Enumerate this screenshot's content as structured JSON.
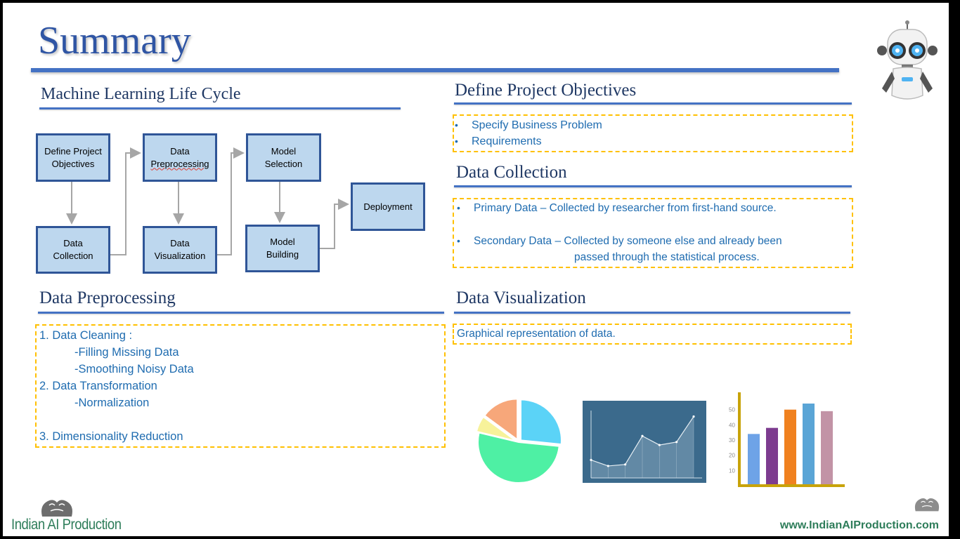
{
  "slide": {
    "title": "Summary",
    "footer_brand": "Indian AI Production",
    "footer_url": "www.IndianAIProduction.com"
  },
  "lifecycle": {
    "heading": "Machine Learning Life Cycle",
    "steps": {
      "define": "Define Project\nObjectives",
      "preprocessing_line1": "Data",
      "preprocessing_line2": "Preprocessing",
      "selection": "Model\nSelection",
      "deployment": "Deployment",
      "collection": "Data\nCollection",
      "visualization": "Data\nVisualization",
      "building": "Model\nBuilding"
    }
  },
  "objectives": {
    "heading": "Define Project Objectives",
    "items": [
      "Specify Business Problem",
      "Requirements"
    ]
  },
  "collection": {
    "heading": "Data Collection",
    "primary": "Primary Data – Collected by researcher from  first-hand source.",
    "secondary_line1": "Secondary Data – Collected by someone else and already been",
    "secondary_line2": "passed through the statistical process."
  },
  "preprocessing": {
    "heading": "Data Preprocessing",
    "lines": [
      "1.   Data Cleaning :",
      "-Filling Missing Data",
      "-Smoothing Noisy Data",
      "2.   Data Transformation",
      "-Normalization",
      "3.   Dimensionality Reduction"
    ]
  },
  "visualization": {
    "heading": "Data Visualization",
    "description": "Graphical representation of data."
  },
  "chart_data": [
    {
      "type": "pie",
      "values": [
        25,
        49,
        6,
        14
      ],
      "colors": [
        "#5bd3f7",
        "#4ef0a4",
        "#f7f29a",
        "#f7a77a"
      ]
    },
    {
      "type": "area",
      "values": [
        12,
        8,
        9,
        28,
        22,
        24,
        41
      ],
      "colors": [
        "#3b6a8c",
        "#d9e6ee"
      ]
    },
    {
      "type": "bar",
      "ticks": [
        "10",
        "20",
        "30",
        "40",
        "50"
      ],
      "values": [
        34,
        38,
        50,
        54,
        49
      ],
      "ylim": [
        0,
        60
      ],
      "colors": [
        "#6ea3e7",
        "#7d3c8f",
        "#f0811f",
        "#5aa5d6",
        "#c293a6"
      ]
    }
  ],
  "icons": {
    "robot": "robot-mascot-icon",
    "brand_logo": "brain-head-logo-icon"
  }
}
